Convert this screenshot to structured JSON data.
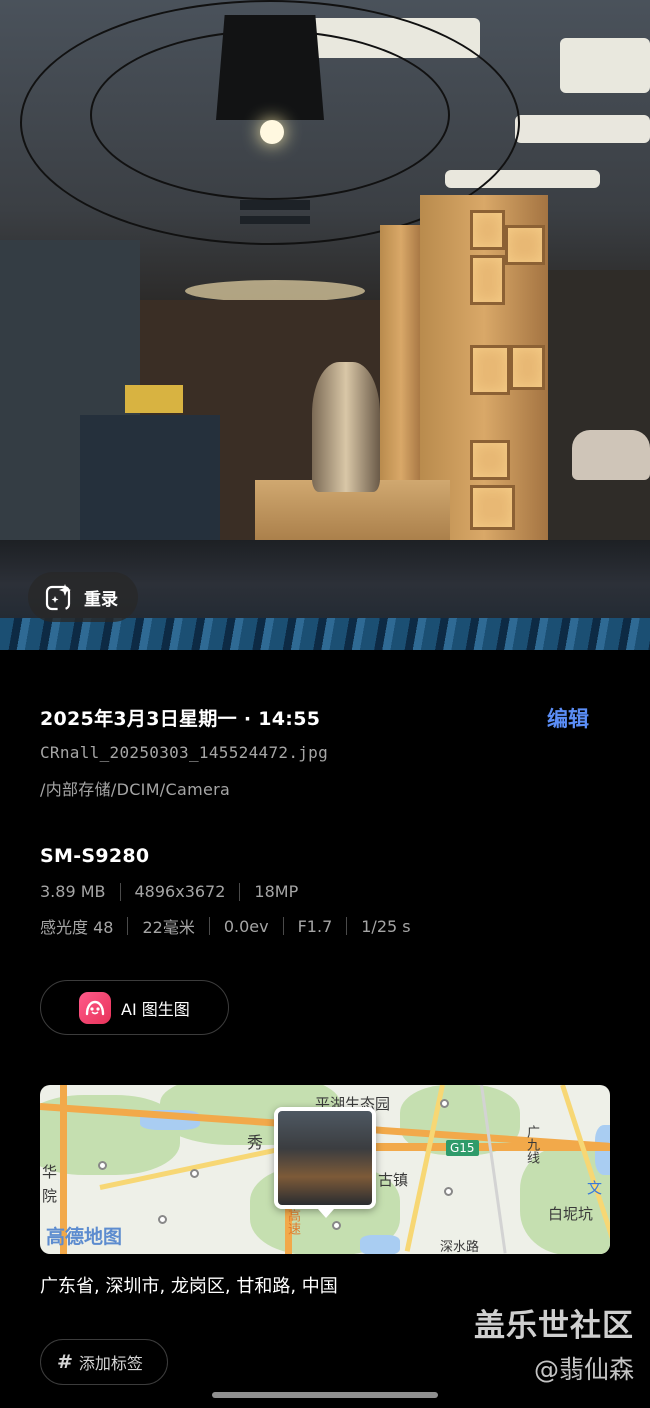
{
  "photo": {
    "rerecord_label": "重录"
  },
  "info": {
    "date": "2025年3月3日星期一 · 14:55",
    "edit_label": "编辑",
    "filename": "CRnall_20250303_145524472.jpg",
    "path": "/内部存储/DCIM/Camera"
  },
  "device": {
    "model": "SM-S9280",
    "file_size": "3.89 MB",
    "resolution": "4896x3672",
    "megapixels": "18MP",
    "iso": "感光度 48",
    "focal_length": "22毫米",
    "exposure": "0.0ev",
    "aperture": "F1.7",
    "shutter": "1/25 s"
  },
  "ai_button": {
    "label": "AI 图生图"
  },
  "map": {
    "brand": "高德地图",
    "labels": {
      "lake": "平湖生态园",
      "town": "古镇",
      "left_partial": "秀",
      "left_col1": "华",
      "left_col2": "院",
      "highway": "G15",
      "line": "广九线",
      "area_right": "白坭坑",
      "speed": "高速",
      "bottom": "深水路",
      "wen": "文"
    }
  },
  "location": "广东省, 深圳市, 龙岗区, 甘和路, 中国",
  "tag_button": {
    "icon": "#",
    "label": "添加标签"
  },
  "watermark": {
    "line1": "盖乐世社区",
    "line2": "@翡仙森"
  },
  "colors": {
    "accent": "#5b8ef7",
    "background": "#000000",
    "secondary_text": "#a5a5a5"
  }
}
